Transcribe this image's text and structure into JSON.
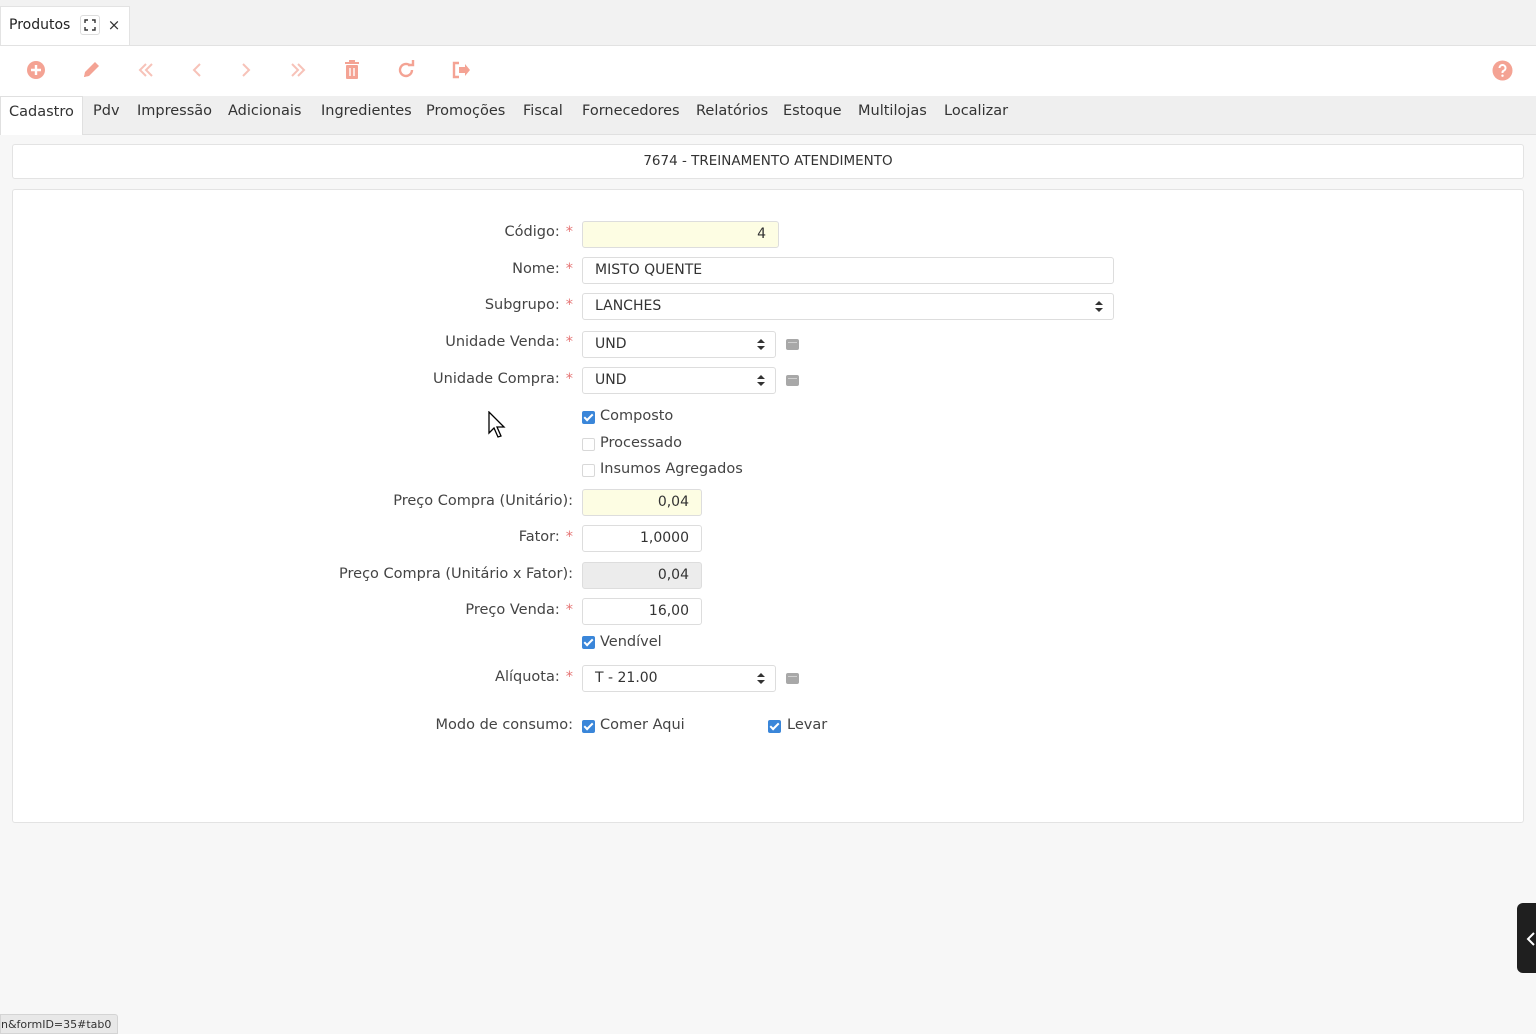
{
  "window": {
    "tab_title": "Produtos",
    "expand_icon": "⛶",
    "close_icon": "×"
  },
  "toolbar": {
    "accent_color": "#f4a394",
    "icons": [
      "add-icon",
      "edit-icon",
      "first-icon",
      "previous-icon",
      "next-icon",
      "last-icon",
      "delete-icon",
      "refresh-icon",
      "exit-icon",
      "help-icon"
    ]
  },
  "tabs": [
    "Cadastro",
    "Pdv",
    "Impressão",
    "Adicionais",
    "Ingredientes",
    "Promoções",
    "Fiscal",
    "Fornecedores",
    "Relatórios",
    "Estoque",
    "Multilojas",
    "Localizar"
  ],
  "header": {
    "title": "7674 - TREINAMENTO ATENDIMENTO"
  },
  "form": {
    "codigo": {
      "label": "Código:",
      "value": "4"
    },
    "nome": {
      "label": "Nome:",
      "value": "MISTO QUENTE"
    },
    "subgrupo": {
      "label": "Subgrupo:",
      "value": "LANCHES"
    },
    "unidade_venda": {
      "label": "Unidade Venda:",
      "value": "UND"
    },
    "unidade_compra": {
      "label": "Unidade Compra:",
      "value": "UND"
    },
    "composto": {
      "label": "Composto",
      "checked": true
    },
    "processado": {
      "label": "Processado",
      "checked": false
    },
    "insumos": {
      "label": "Insumos Agregados",
      "checked": false
    },
    "preco_compra": {
      "label": "Preço Compra (Unitário):",
      "value": "0,04"
    },
    "fator": {
      "label": "Fator:",
      "value": "1,0000"
    },
    "preco_compra_fator": {
      "label": "Preço Compra (Unitário x Fator):",
      "value": "0,04"
    },
    "preco_venda": {
      "label": "Preço Venda:",
      "value": "16,00"
    },
    "vendivel": {
      "label": "Vendível",
      "checked": true
    },
    "aliquota": {
      "label": "Alíquota:",
      "value": "T - 21.00"
    },
    "modo_consumo": {
      "label": "Modo de consumo:",
      "comer_aqui": "Comer Aqui",
      "levar": "Levar"
    },
    "required_mark": "*"
  },
  "status_bar": {
    "text": "n&formID=35#tab0"
  }
}
